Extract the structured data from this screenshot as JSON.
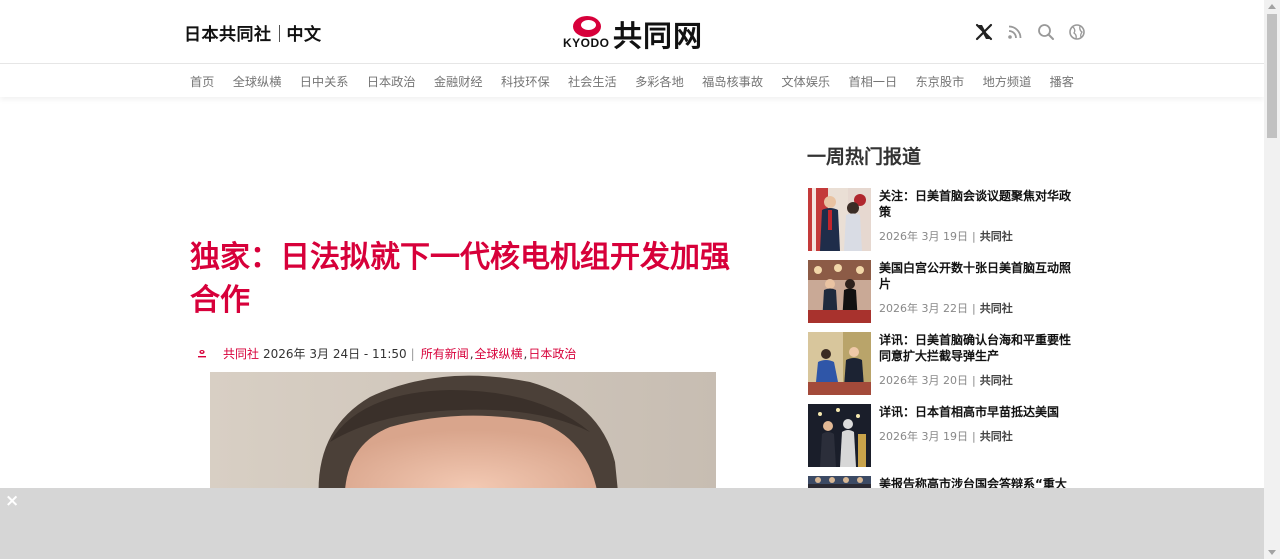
{
  "header": {
    "site_name": "日本共同社",
    "language": "中文",
    "logo_kyodo": "KYODO",
    "logo_cn": "共同网",
    "icons": [
      "x-icon",
      "rss-icon",
      "search-icon",
      "globe-icon"
    ],
    "accent_color": "#d7003a"
  },
  "nav": {
    "items": [
      "首页",
      "全球纵横",
      "日中关系",
      "日本政治",
      "金融财经",
      "科技环保",
      "社会生活",
      "多彩各地",
      "福岛核事故",
      "文体娱乐",
      "首相一日",
      "东京股市",
      "地方频道",
      "播客"
    ]
  },
  "article": {
    "headline": "独家：日法拟就下一代核电机组开发加强合作",
    "author": "共同社",
    "date": "2026年 3月 24日 - 11:50",
    "separator": "|",
    "categories": [
      "所有新闻",
      "全球纵横",
      "日本政治"
    ],
    "comma": ","
  },
  "sidebar": {
    "title": "一周热门报道",
    "separator": "|",
    "items": [
      {
        "title": "关注：日美首脑会谈议题聚焦对华政策",
        "date": "2026年 3月 19日",
        "source": "共同社"
      },
      {
        "title": "美国白宫公开数十张日美首脑互动照片",
        "date": "2026年 3月 22日",
        "source": "共同社"
      },
      {
        "title": "详讯：日美首脑确认台海和平重要性 同意扩大拦截导弹生产",
        "date": "2026年 3月 20日",
        "source": "共同社"
      },
      {
        "title": "详讯：日本首相高市早苗抵达美国",
        "date": "2026年 3月 19日",
        "source": "共同社"
      },
      {
        "title": "美报告称高市涉台国会答辩系“重大",
        "date": "",
        "source": ""
      }
    ]
  },
  "ad": {
    "close_label": "×"
  }
}
